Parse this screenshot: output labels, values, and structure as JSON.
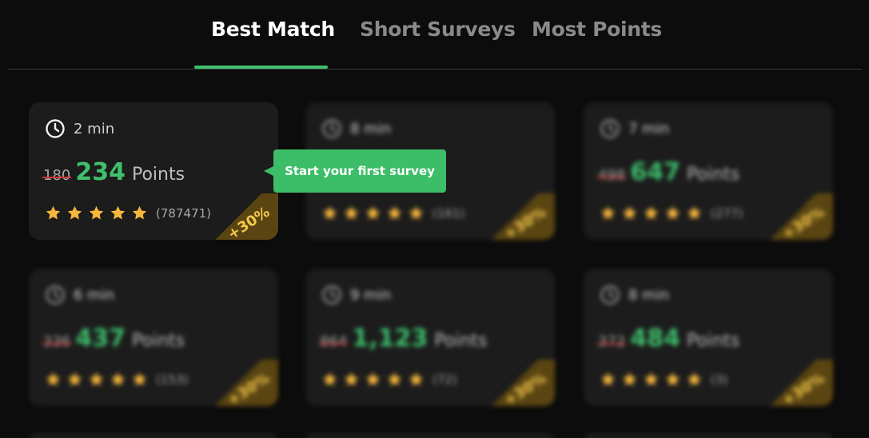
{
  "tabs": [
    {
      "label": "Best Match",
      "active": true
    },
    {
      "label": "Short Surveys",
      "active": false
    },
    {
      "label": "Most Points",
      "active": false
    }
  ],
  "colors": {
    "accent": "#3ec06d",
    "background": "#0c0c0c",
    "card": "#1c1c1c",
    "star": "#f6b73c",
    "strike": "#d0372f",
    "ribbon_text": "#f6c94a"
  },
  "icons": {
    "time": "clock-icon",
    "rating": "star-icon"
  },
  "points_label": "Points",
  "bonus_label": "+30%",
  "tooltip": {
    "text": "Start your first survey"
  },
  "cards": [
    {
      "time": "2 min",
      "old_points": "180",
      "points": "234",
      "stars": 5,
      "rating_count": "(787471)"
    },
    {
      "time": "8 min",
      "old_points": "",
      "points": "",
      "stars": 5,
      "rating_count": "(161)"
    },
    {
      "time": "7 min",
      "old_points": "498",
      "points": "647",
      "stars": 5,
      "rating_count": "(277)"
    },
    {
      "time": "6 min",
      "old_points": "336",
      "points": "437",
      "stars": 5,
      "rating_count": "(153)"
    },
    {
      "time": "9 min",
      "old_points": "864",
      "points": "1,123",
      "stars": 5,
      "rating_count": "(72)"
    },
    {
      "time": "8 min",
      "old_points": "372",
      "points": "484",
      "stars": 5,
      "rating_count": "(3)"
    }
  ]
}
